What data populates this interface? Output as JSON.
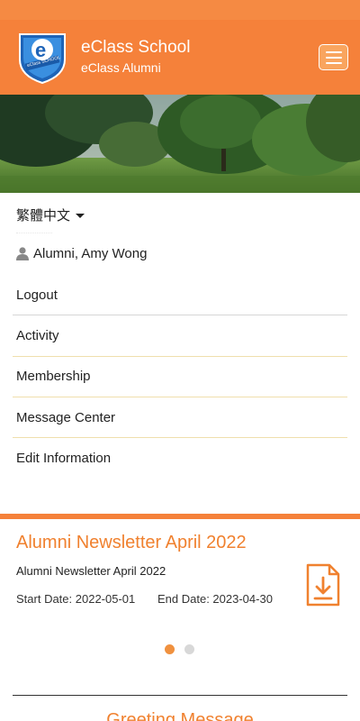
{
  "header": {
    "school_name": "eClass School",
    "school_sub": "eClass Alumni",
    "logo_letter": "e",
    "logo_text": "eClass SCHOOL",
    "menu_icon": "hamburger-icon"
  },
  "language": {
    "label": "繁體中文",
    "icon": "caret-down-icon"
  },
  "user": {
    "name": "Alumni, Amy Wong",
    "icon": "user-icon"
  },
  "menu": {
    "items": [
      {
        "label": "Logout"
      },
      {
        "label": "Activity"
      },
      {
        "label": "Membership"
      },
      {
        "label": "Message Center"
      },
      {
        "label": "Edit Information"
      }
    ]
  },
  "newsletter": {
    "title": "Alumni Newsletter April 2022",
    "subtitle": "Alumni Newsletter April 2022",
    "start": "Start Date: 2022-05-01",
    "end": "End Date: 2023-04-30",
    "icon": "file-download-icon"
  },
  "carousel": {
    "total": 2,
    "active": 1
  },
  "greeting": {
    "title": "Greeting Message"
  },
  "colors": {
    "brand": "#f5813a",
    "accent": "#f0812f",
    "divider": "#f0dfad"
  }
}
